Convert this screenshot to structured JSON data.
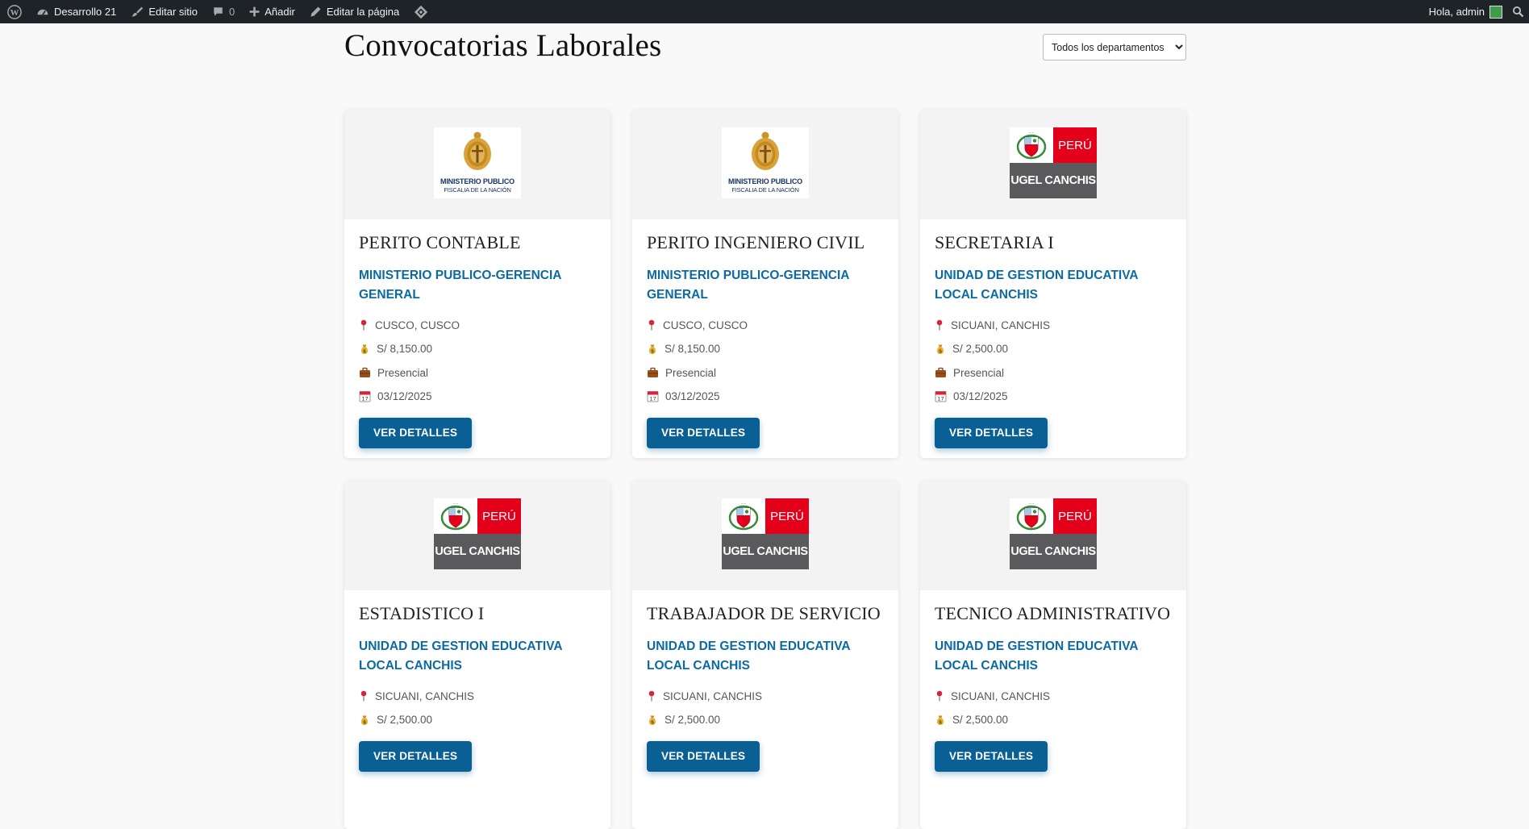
{
  "adminbar": {
    "site_name": "Desarrollo 21",
    "edit_site": "Editar sitio",
    "comments_count": "0",
    "add_new": "Añadir",
    "edit_page": "Editar la página",
    "greeting": "Hola, admin"
  },
  "page": {
    "title": "Convocatorias Laborales",
    "department_select": {
      "selected": "Todos los departamentos",
      "options": [
        "Todos los departamentos"
      ]
    }
  },
  "logos": {
    "mp": {
      "line1": "MINISTERIO PUBLICO",
      "line2": "FISCALIA DE LA NACIÓN"
    },
    "ugel": {
      "country": "PERÚ",
      "name": "UGEL CANCHIS"
    }
  },
  "button_label": "VER DETALLES",
  "jobs": [
    {
      "logo": "mp",
      "title": "PERITO CONTABLE",
      "employer": "MINISTERIO PUBLICO-GERENCIA GENERAL",
      "location": "CUSCO, CUSCO",
      "salary": "S/ 8,150.00",
      "modality": "Presencial",
      "date": "03/12/2025"
    },
    {
      "logo": "mp",
      "title": "PERITO INGENIERO CIVIL",
      "employer": "MINISTERIO PUBLICO-GERENCIA GENERAL",
      "location": "CUSCO, CUSCO",
      "salary": "S/ 8,150.00",
      "modality": "Presencial",
      "date": "03/12/2025"
    },
    {
      "logo": "ugel",
      "title": "SECRETARIA I",
      "employer": "UNIDAD DE GESTION EDUCATIVA LOCAL CANCHIS",
      "location": "SICUANI, CANCHIS",
      "salary": "S/ 2,500.00",
      "modality": "Presencial",
      "date": "03/12/2025"
    },
    {
      "logo": "ugel",
      "title": "ESTADISTICO I",
      "employer": "UNIDAD DE GESTION EDUCATIVA LOCAL CANCHIS",
      "location": "SICUANI, CANCHIS",
      "salary": "S/ 2,500.00"
    },
    {
      "logo": "ugel",
      "title": "TRABAJADOR DE SERVICIO",
      "employer": "UNIDAD DE GESTION EDUCATIVA LOCAL CANCHIS",
      "location": "SICUANI, CANCHIS",
      "salary": "S/ 2,500.00"
    },
    {
      "logo": "ugel",
      "title": "TECNICO ADMINISTRATIVO",
      "employer": "UNIDAD DE GESTION EDUCATIVA LOCAL CANCHIS",
      "location": "SICUANI, CANCHIS",
      "salary": "S/ 2,500.00"
    }
  ]
}
